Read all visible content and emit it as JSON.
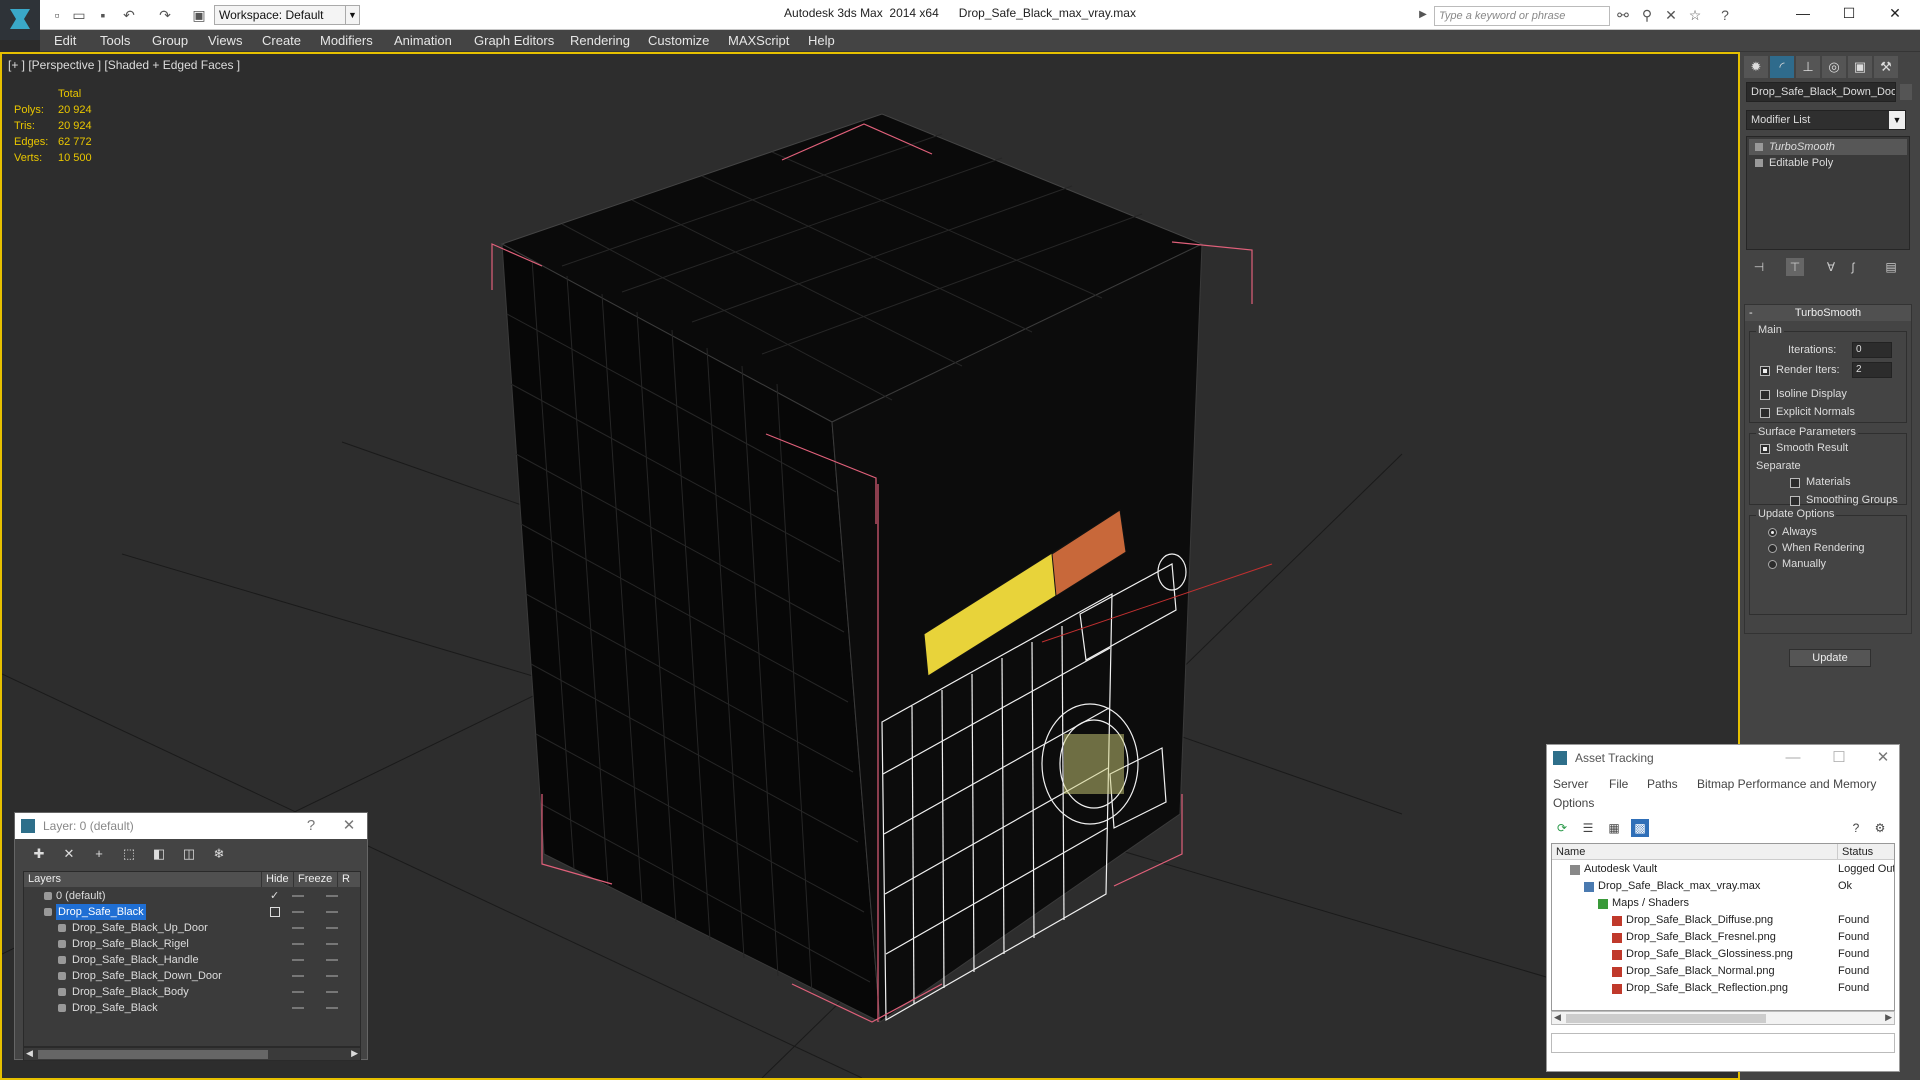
{
  "titlebar": {
    "workspace": "Workspace: Default",
    "app_title": "Autodesk 3ds Max  2014 x64      Drop_Safe_Black_max_vray.max",
    "search_placeholder": "Type a keyword or phrase"
  },
  "menu": [
    "Edit",
    "Tools",
    "Group",
    "Views",
    "Create",
    "Modifiers",
    "Animation",
    "Graph Editors",
    "Rendering",
    "Customize",
    "MAXScript",
    "Help"
  ],
  "viewport": {
    "label": "[+ ] [Perspective ] [Shaded + Edged Faces ]",
    "stats": {
      "header": "Total",
      "rows": [
        {
          "label": "Polys:",
          "value": "20 924"
        },
        {
          "label": "Tris:",
          "value": "20 924"
        },
        {
          "label": "Edges:",
          "value": "62 772"
        },
        {
          "label": "Verts:",
          "value": "10 500"
        }
      ]
    }
  },
  "command_panel": {
    "object_name": "Drop_Safe_Black_Down_Door",
    "modifier_list": "Modifier List",
    "stack": [
      "TurboSmooth",
      "Editable Poly"
    ],
    "turbosmooth": {
      "title": "TurboSmooth",
      "main": "Main",
      "iterations_label": "Iterations:",
      "iterations": "0",
      "render_iters_label": "Render Iters:",
      "render_iters": "2",
      "isoline": "Isoline Display",
      "explicit_normals": "Explicit Normals",
      "surface_params": "Surface Parameters",
      "smooth_result": "Smooth Result",
      "separate": "Separate",
      "materials": "Materials",
      "smoothing_groups": "Smoothing Groups",
      "update_options": "Update Options",
      "always": "Always",
      "when_rendering": "When Rendering",
      "manually": "Manually",
      "update_btn": "Update"
    }
  },
  "layer_window": {
    "title": "Layer: 0 (default)",
    "help": "?",
    "headers": {
      "layers": "Layers",
      "hide": "Hide",
      "freeze": "Freeze",
      "r": "R"
    },
    "rows": [
      {
        "name": "0 (default)",
        "level": 1,
        "selected": false
      },
      {
        "name": "Drop_Safe_Black",
        "level": 1,
        "selected": true
      },
      {
        "name": "Drop_Safe_Black_Up_Door",
        "level": 2,
        "selected": false
      },
      {
        "name": "Drop_Safe_Black_Rigel",
        "level": 2,
        "selected": false
      },
      {
        "name": "Drop_Safe_Black_Handle",
        "level": 2,
        "selected": false
      },
      {
        "name": "Drop_Safe_Black_Down_Door",
        "level": 2,
        "selected": false
      },
      {
        "name": "Drop_Safe_Black_Body",
        "level": 2,
        "selected": false
      },
      {
        "name": "Drop_Safe_Black",
        "level": 2,
        "selected": false
      }
    ]
  },
  "asset_tracking": {
    "title": "Asset Tracking",
    "menu": [
      "Server",
      "File",
      "Paths",
      "Bitmap Performance and Memory",
      "Options"
    ],
    "headers": {
      "name": "Name",
      "status": "Status"
    },
    "rows": [
      {
        "name": "Autodesk Vault",
        "status": "Logged Out",
        "level": 0,
        "icon": "vault"
      },
      {
        "name": "Drop_Safe_Black_max_vray.max",
        "status": "Ok",
        "level": 1,
        "icon": "max"
      },
      {
        "name": "Maps / Shaders",
        "status": "",
        "level": 2,
        "icon": "maps"
      },
      {
        "name": "Drop_Safe_Black_Diffuse.png",
        "status": "Found",
        "level": 3,
        "icon": "png"
      },
      {
        "name": "Drop_Safe_Black_Fresnel.png",
        "status": "Found",
        "level": 3,
        "icon": "png"
      },
      {
        "name": "Drop_Safe_Black_Glossiness.png",
        "status": "Found",
        "level": 3,
        "icon": "png"
      },
      {
        "name": "Drop_Safe_Black_Normal.png",
        "status": "Found",
        "level": 3,
        "icon": "png"
      },
      {
        "name": "Drop_Safe_Black_Reflection.png",
        "status": "Found",
        "level": 3,
        "icon": "png"
      }
    ]
  },
  "colors": {
    "accent_yellow": "#e6c000",
    "selection_blue": "#1f6fd4",
    "bbox_pink": "#e0607a"
  }
}
